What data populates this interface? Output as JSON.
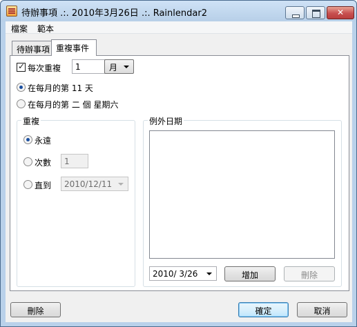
{
  "window": {
    "title": "待辦事項 .:. 2010年3月26日 .:. Rainlendar2"
  },
  "menu": {
    "items": [
      "檔案",
      "範本"
    ]
  },
  "tabs": [
    {
      "label": "待辦事項",
      "active": false
    },
    {
      "label": "重複事件",
      "active": true
    }
  ],
  "repeat": {
    "every_label": "每次重複",
    "every_checked": true,
    "every_value": "1",
    "unit_value": "月",
    "day_option_label": "在每月的第 11 天",
    "weekday_option_label": "在每月的第 二 個 星期六",
    "selected_option": "day"
  },
  "repeat_group": {
    "title": "重複",
    "forever_label": "永遠",
    "count_label": "次數",
    "count_value": "1",
    "until_label": "直到",
    "until_value": "2010/12/11",
    "selected": "forever"
  },
  "exceptions": {
    "title": "例外日期",
    "date_value": "2010/  3/26",
    "add_label": "增加",
    "remove_label": "刪除"
  },
  "footer": {
    "delete_label": "刪除",
    "ok_label": "確定",
    "cancel_label": "取消"
  },
  "colors": {
    "titlebar": "#b9d1ea",
    "accent": "#3c7fb1"
  }
}
